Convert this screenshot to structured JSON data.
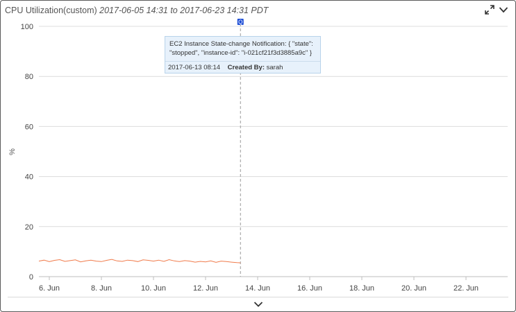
{
  "header": {
    "metric_name": "CPU Utilization(custom)",
    "time_range": "2017-06-05 14:31 to 2017-06-23 14:31 PDT"
  },
  "icons": {
    "expand": "expand-arrows-icon",
    "menu": "chevron-down-icon",
    "footer_toggle": "chevron-down-icon",
    "annotation": "annotation-marker-icon"
  },
  "colors": {
    "series": "#f07a4a",
    "annotation_line": "#9a9a9a",
    "annotation_marker": "#1f4fd6",
    "tooltip_bg": "#e7f1fb"
  },
  "annotation": {
    "marker_glyph": "Q",
    "text": "EC2 Instance State-change Notification: { \"state\": \"stopped\", \"instance-id\": \"i-021cf21f3d3885a9c\" }",
    "line1": "EC2 Instance State-change Notification: { \"state\":",
    "line2": "\"stopped\", \"instance-id\": \"i-021cf21f3d3885a9c\" }",
    "date": "2017-06-13 08:14",
    "created_by_label": "Created By:",
    "created_by": "sarah",
    "day": 13.34
  },
  "chart_data": {
    "type": "line",
    "title": "CPU Utilization(custom) 2017-06-05 14:31 to 2017-06-23 14:31 PDT",
    "xlabel": "",
    "ylabel": "%",
    "ylim": [
      0,
      100
    ],
    "yticks": [
      0,
      20,
      40,
      60,
      80,
      100
    ],
    "xticks": [
      "6. Jun",
      "8. Jun",
      "10. Jun",
      "12. Jun",
      "14. Jun",
      "16. Jun",
      "18. Jun",
      "20. Jun",
      "22. Jun"
    ],
    "xtick_days": [
      6,
      8,
      10,
      12,
      14,
      16,
      18,
      20,
      22
    ],
    "xlim_days": [
      5.6,
      23.6
    ],
    "grid": true,
    "series": [
      {
        "name": "",
        "x_days": [
          5.6,
          5.8,
          6.0,
          6.2,
          6.4,
          6.6,
          6.8,
          7.0,
          7.2,
          7.4,
          7.6,
          7.8,
          8.0,
          8.2,
          8.4,
          8.6,
          8.8,
          9.0,
          9.2,
          9.4,
          9.6,
          9.8,
          10.0,
          10.2,
          10.4,
          10.6,
          10.8,
          11.0,
          11.2,
          11.4,
          11.6,
          11.8,
          12.0,
          12.2,
          12.4,
          12.6,
          12.8,
          13.0,
          13.2,
          13.34
        ],
        "values": [
          6.2,
          6.6,
          6.0,
          6.5,
          6.8,
          6.1,
          6.4,
          6.7,
          5.9,
          6.3,
          6.6,
          6.2,
          6.0,
          6.5,
          6.9,
          6.3,
          6.1,
          6.6,
          6.4,
          6.0,
          6.7,
          6.5,
          6.2,
          6.6,
          6.1,
          6.8,
          6.3,
          6.0,
          6.4,
          6.2,
          5.8,
          6.1,
          5.9,
          6.3,
          5.7,
          6.2,
          6.0,
          5.8,
          5.6,
          5.5
        ]
      }
    ]
  }
}
